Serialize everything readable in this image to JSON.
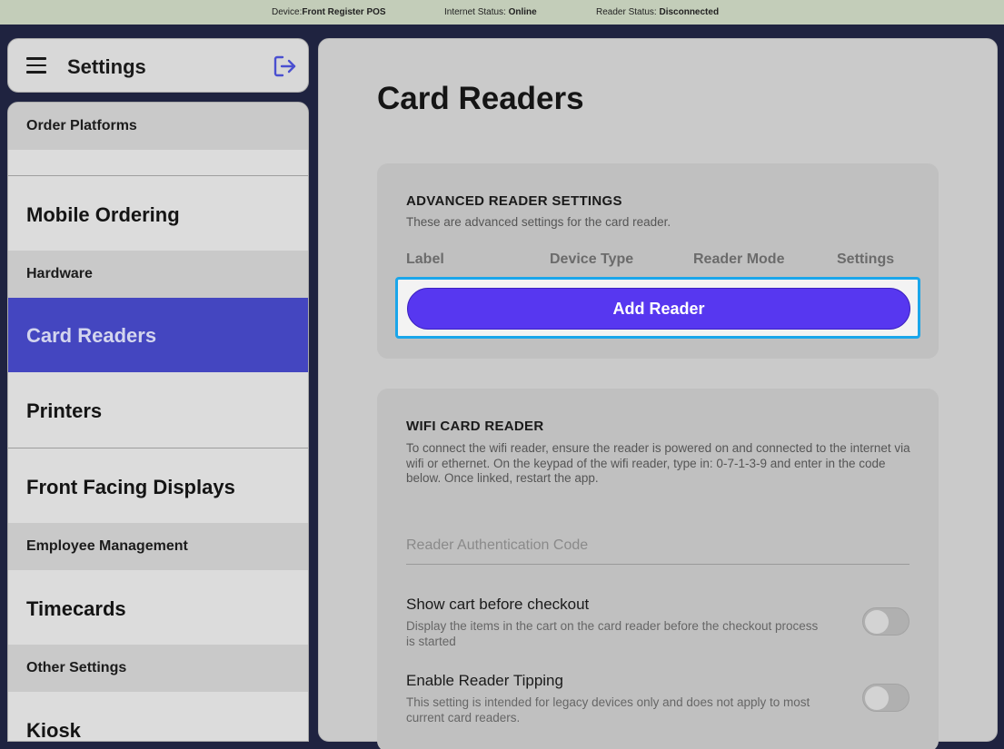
{
  "status_bar": {
    "device_label": "Device:",
    "device_value": "Front Register POS",
    "internet_label": "Internet Status: ",
    "internet_value": "Online",
    "reader_label": "Reader Status: ",
    "reader_value": "Disconnected"
  },
  "sidebar_header": {
    "title": "Settings",
    "menu_icon": "hamburger-icon",
    "logout_icon": "logout-icon"
  },
  "sidebar": {
    "sections": {
      "order_platforms": "Order Platforms",
      "hardware": "Hardware",
      "employee_management": "Employee Management",
      "other_settings": "Other Settings"
    },
    "items": {
      "mobile_ordering": "Mobile Ordering",
      "card_readers": "Card Readers",
      "printers": "Printers",
      "front_facing_displays": "Front Facing Displays",
      "timecards": "Timecards",
      "kiosk": "Kiosk"
    },
    "active_item": "card_readers"
  },
  "main": {
    "title": "Card Readers",
    "advanced": {
      "title": "ADVANCED READER SETTINGS",
      "description": "These are advanced settings for the card reader.",
      "columns": [
        "Label",
        "Device Type",
        "Reader Mode",
        "Settings"
      ],
      "add_button": "Add Reader"
    },
    "wifi": {
      "title": "WIFI CARD READER",
      "description": "To connect the wifi reader, ensure the reader is powered on and connected to the internet via wifi or ethernet. On the keypad of the wifi reader, type in: 0-7-1-3-9 and enter in the code below. Once linked, restart the app.",
      "auth_placeholder": "Reader Authentication Code",
      "auth_value": "",
      "options": [
        {
          "title": "Show cart before checkout",
          "description": "Display the items in the cart on the card reader before the checkout process is started",
          "enabled": false
        },
        {
          "title": "Enable Reader Tipping",
          "description": "This setting is intended for legacy devices only and does not apply to most current card readers.",
          "enabled": false
        }
      ]
    }
  },
  "colors": {
    "accent": "#5737f0",
    "active_nav": "#4446c0",
    "focus_ring": "#1aa6ea",
    "status_bar": "#c3cdb9",
    "frame": "#1f2340"
  }
}
